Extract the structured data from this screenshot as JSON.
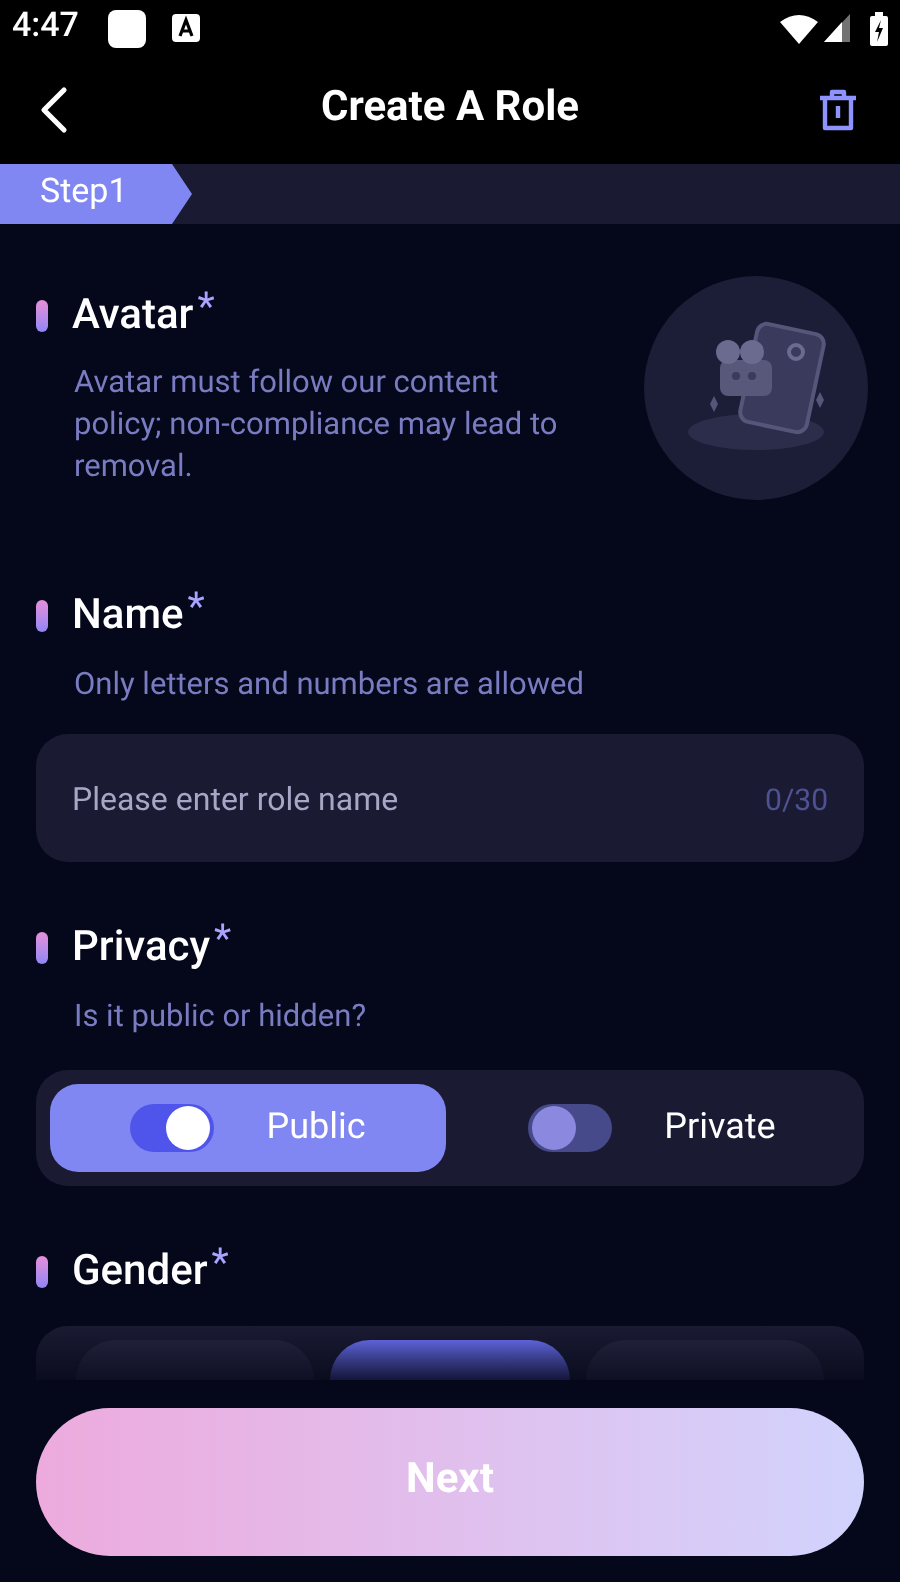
{
  "status_bar": {
    "time": "4:47"
  },
  "header": {
    "title": "Create A Role"
  },
  "step": {
    "label": "Step1"
  },
  "avatar": {
    "title": "Avatar",
    "required_mark": "*",
    "description": "Avatar must follow our content policy; non-compliance may lead to removal."
  },
  "name": {
    "title": "Name",
    "required_mark": "*",
    "description": "Only letters and numbers are allowed",
    "placeholder": "Please enter role name",
    "counter": "0/30"
  },
  "privacy": {
    "title": "Privacy",
    "required_mark": "*",
    "description": "Is it public or hidden?",
    "options": [
      {
        "label": "Public",
        "selected": true
      },
      {
        "label": "Private",
        "selected": false
      }
    ]
  },
  "gender": {
    "title": "Gender",
    "required_mark": "*",
    "options": [
      {
        "selected": false
      },
      {
        "selected": true
      },
      {
        "selected": false
      }
    ]
  },
  "next_button": {
    "label": "Next"
  }
}
